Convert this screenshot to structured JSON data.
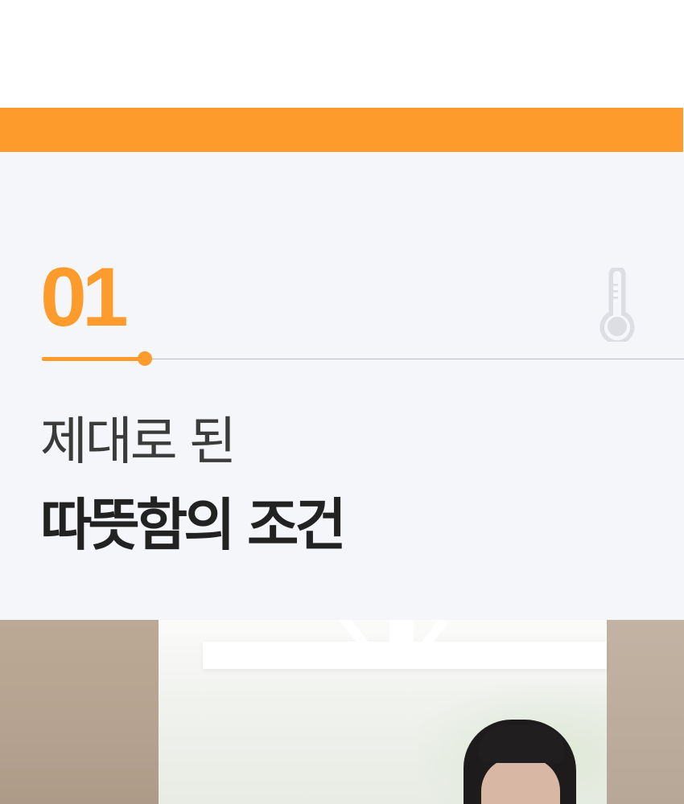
{
  "section": {
    "number": "01",
    "icon": "thermometer-icon",
    "subtitle": "제대로 된",
    "title": "따뜻함의 조건"
  },
  "colors": {
    "accent": "#fd9c2c",
    "section_background": "#f5f6fa",
    "title_text": "#222222",
    "subtitle_text": "#3b3b3b",
    "icon": "#dcdee3"
  }
}
